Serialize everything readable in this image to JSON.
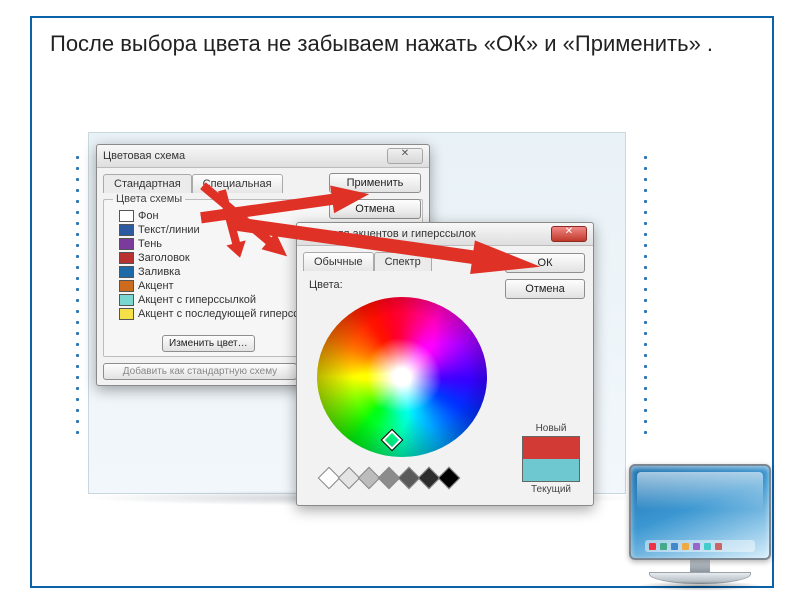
{
  "caption": "После выбора цвета не забываем нажать  «ОК» и «Применить» .",
  "scheme_dialog": {
    "title": "Цветовая схема",
    "tabs": [
      "Стандартная",
      "Специальная"
    ],
    "group_label": "Цвета схемы",
    "items": [
      {
        "label": "Фон",
        "color": "#ffffff"
      },
      {
        "label": "Текст/линии",
        "color": "#2c5aa0"
      },
      {
        "label": "Тень",
        "color": "#7a3b9d"
      },
      {
        "label": "Заголовок",
        "color": "#b83232"
      },
      {
        "label": "Заливка",
        "color": "#1e6aa8"
      },
      {
        "label": "Акцент",
        "color": "#cc6a1e"
      },
      {
        "label": "Акцент с гиперссылкой",
        "color": "#7ad7d0"
      },
      {
        "label": "Акцент с последующей гиперссылкой",
        "color": "#f4e14a"
      }
    ],
    "change_color": "Изменить цвет…",
    "add_scheme": "Добавить как стандартную схему",
    "apply": "Применить",
    "cancel": "Отмена"
  },
  "color_dialog": {
    "title": "Цвет для акцентов и гиперссылок",
    "tabs": [
      "Обычные",
      "Спектр"
    ],
    "colors_label": "Цвета:",
    "ok": "ОК",
    "cancel": "Отмена",
    "new_label": "Новый",
    "current_label": "Текущий",
    "new_color": "#d23a36",
    "current_color": "#6ec8cf"
  },
  "grays": [
    "#ffffff",
    "#e4e4e4",
    "#bcbcbc",
    "#8c8c8c",
    "#5a5a5a",
    "#2c2c2c",
    "#000000"
  ]
}
